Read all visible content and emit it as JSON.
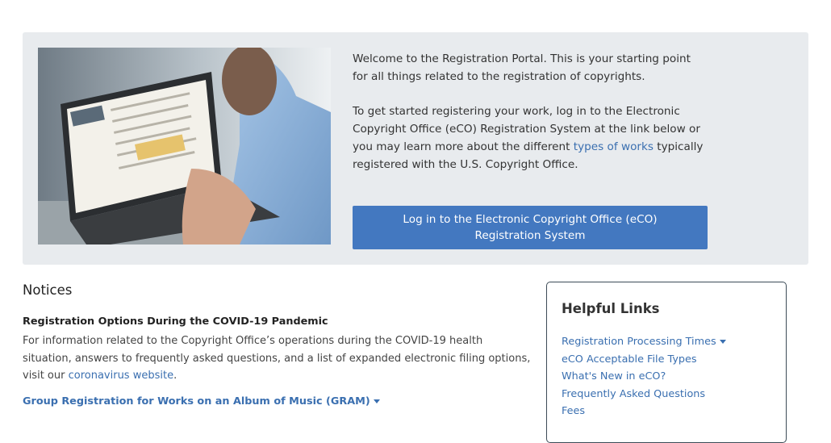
{
  "hero": {
    "paragraph1": "Welcome to the Registration Portal. This is your starting point for all things related to the registration of copyrights.",
    "paragraph2_before": "To get started registering your work, log in to the Electronic Copyright Office (eCO) Registration System at the link below or you may learn more about the different ",
    "paragraph2_link": "types of works",
    "paragraph2_after": " typically registered with the U.S. Copyright Office.",
    "login_button": "Log in to the Electronic Copyright Office (eCO) Registration System"
  },
  "notices": {
    "heading": "Notices",
    "items": [
      {
        "title": "Registration Options During the COVID-19 Pandemic",
        "body_before": "For information related to the Copyright Office’s operations during the COVID-19 health situation, answers to frequently asked questions, and a list of expanded electronic filing options, visit our ",
        "body_link": "coronavirus website",
        "body_after": "."
      }
    ],
    "toggle_label": "Group Registration for Works on an Album of Music (GRAM)"
  },
  "helpful_links": {
    "heading": "Helpful Links",
    "links": [
      "Registration Processing Times",
      "eCO Acceptable File Types",
      "What's New in eCO?",
      "Frequently Asked Questions",
      "Fees"
    ]
  },
  "colors": {
    "accent": "#4378c0",
    "link": "#3a6fb0",
    "hero_background": "#e8ebee"
  }
}
